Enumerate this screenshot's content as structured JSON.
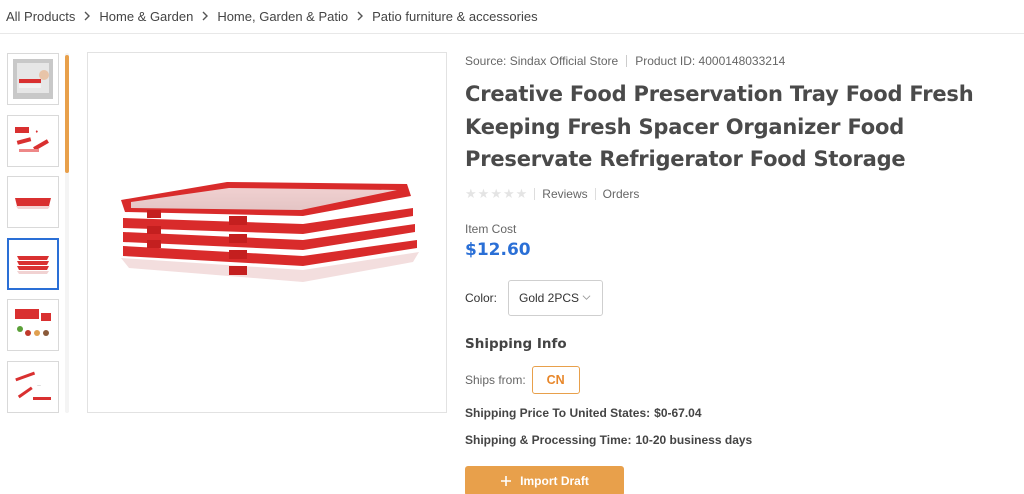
{
  "breadcrumb": [
    {
      "label": "All Products"
    },
    {
      "label": "Home & Garden"
    },
    {
      "label": "Home, Garden & Patio"
    },
    {
      "label": "Patio furniture & accessories"
    }
  ],
  "product": {
    "source": "Source: Sindax Official Store",
    "product_id": "Product ID: 4000148033214",
    "title": "Creative Food Preservation Tray Food Fresh Keeping Fresh Spacer Organizer Food Preservate Refrigerator Food Storage",
    "rating_stars": 0,
    "reviews_label": "Reviews",
    "orders_label": "Orders",
    "cost_label": "Item Cost",
    "cost_value": "$12.60",
    "color_label": "Color:",
    "color_selected": "Gold 2PCS"
  },
  "shipping": {
    "heading": "Shipping Info",
    "ships_from_label": "Ships from:",
    "ships_from_value": "CN",
    "price_label": "Shipping Price To United States:",
    "price_value": "$0-67.04",
    "time_label": "Shipping & Processing Time:",
    "time_value": "10-20 business days"
  },
  "actions": {
    "import_label": "Import Draft"
  },
  "colors": {
    "accent": "#e8a04b",
    "price_blue": "#2a6fd6",
    "tray_red": "#d92b2b"
  }
}
